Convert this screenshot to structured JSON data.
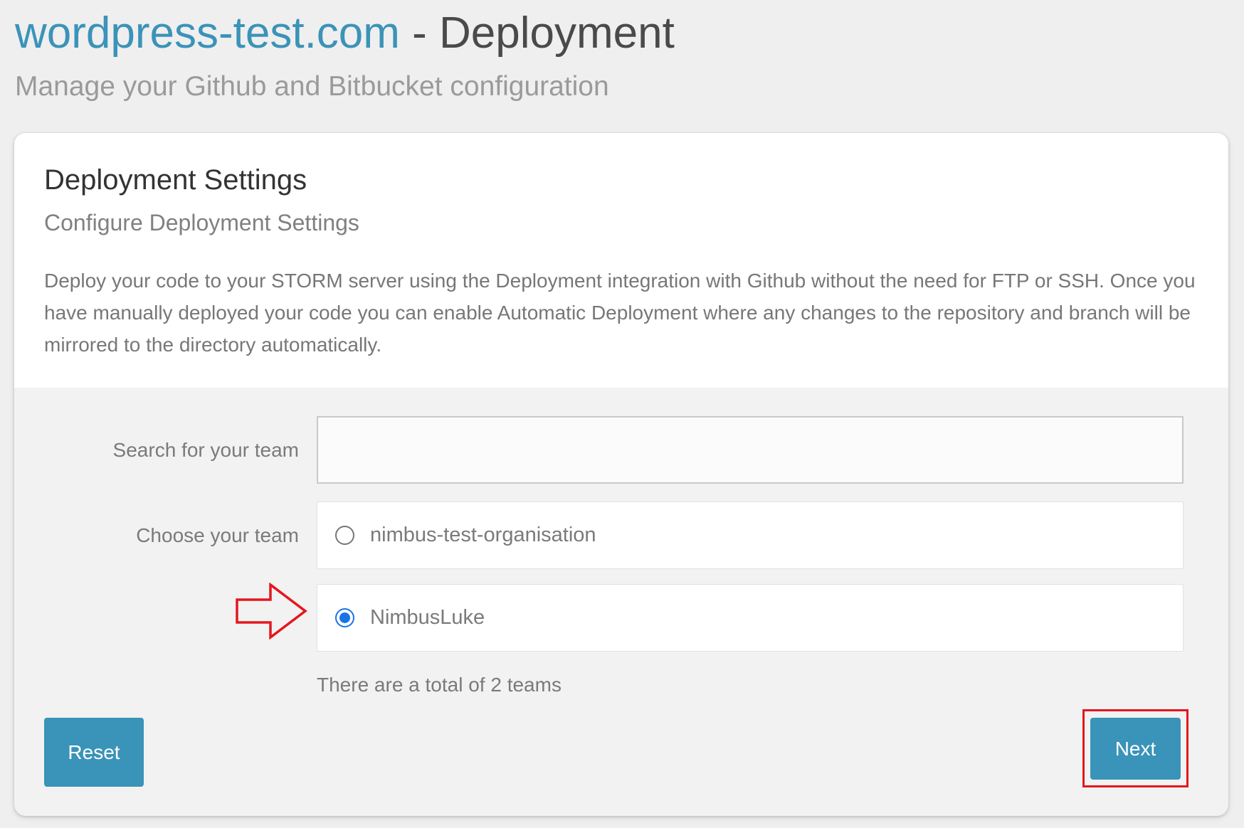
{
  "header": {
    "site_name": "wordpress-test.com",
    "title_separator": " - Deployment",
    "subtitle": "Manage your Github and Bitbucket configuration"
  },
  "card": {
    "title": "Deployment Settings",
    "subtitle": "Configure Deployment Settings",
    "description": "Deploy your code to your STORM server using the Deployment integration with Github without the need for FTP or SSH. Once you have manually deployed your code you can enable Automatic Deployment where any changes to the repository and branch will be mirrored to the directory automatically."
  },
  "form": {
    "search_label": "Search for your team",
    "search_value": "",
    "choose_label": "Choose your team",
    "teams": [
      {
        "name": "nimbus-test-organisation",
        "selected": false
      },
      {
        "name": "NimbusLuke",
        "selected": true
      }
    ],
    "team_count_text": "There are a total of 2 teams"
  },
  "buttons": {
    "reset_label": "Reset",
    "next_label": "Next"
  },
  "annotations": {
    "arrow_color": "#e3171e",
    "highlight_color": "#e3171e"
  },
  "colors": {
    "accent": "#3a93b8",
    "link": "#3b93b8",
    "radio_checked": "#1a73e8"
  }
}
